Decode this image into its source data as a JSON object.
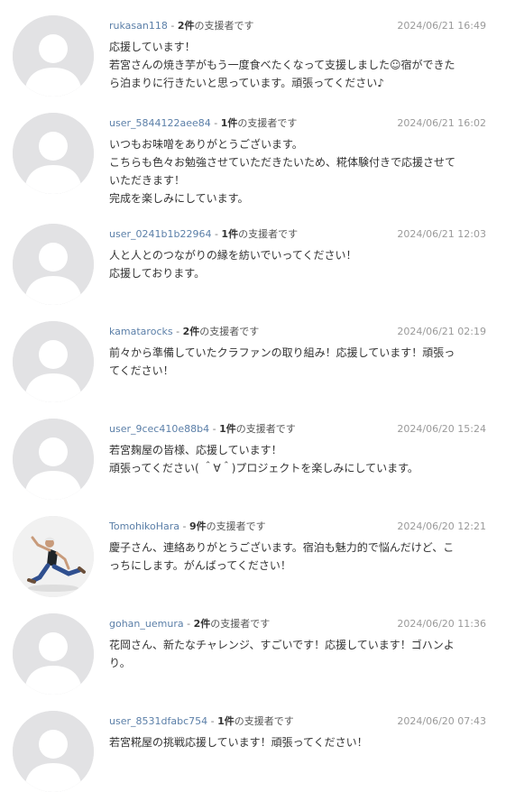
{
  "suffix": "の支援者です",
  "comments": [
    {
      "user": "rukasan118",
      "count": "2件",
      "date": "2024/06/21 16:49",
      "avatar": "default-avatar",
      "lines": [
        "応援しています！",
        "若宮さんの焼き芋がもう一度食べたくなって支援しました☺宿ができた",
        "ら泊まりに行きたいと思っています。頑張ってください♪"
      ]
    },
    {
      "user": "user_5844122aee84",
      "count": "1件",
      "date": "2024/06/21 16:02",
      "avatar": "default-avatar",
      "lines": [
        "いつもお味噌をありがとうございます。",
        "こちらも色々お勉強させていただきたいため、糀体験付きで応援させて",
        "いただきます！",
        "完成を楽しみにしています。"
      ]
    },
    {
      "user": "user_0241b1b22964",
      "count": "1件",
      "date": "2024/06/21 12:03",
      "avatar": "default-avatar",
      "lines": [
        "人と人とのつながりの縁を紡いでいってください！",
        "応援しております。"
      ]
    },
    {
      "user": "kamatarocks",
      "count": "2件",
      "date": "2024/06/21 02:19",
      "avatar": "default-avatar",
      "lines": [
        "前々から準備していたクラファンの取り組み！応援しています！頑張っ",
        "てください！"
      ]
    },
    {
      "user": "user_9cec410e88b4",
      "count": "1件",
      "date": "2024/06/20 15:24",
      "avatar": "default-avatar",
      "lines": [
        "若宮麹屋の皆様、応援しています！",
        "頑張ってください( ＾∀＾)プロジェクトを楽しみにしています。"
      ]
    },
    {
      "user": "TomohikoHara",
      "count": "9件",
      "date": "2024/06/20 12:21",
      "avatar": "jumping-person-photo",
      "lines": [
        "慶子さん、連絡ありがとうございます。宿泊も魅力的で悩んだけど、こ",
        "っちにします。がんばってください！"
      ]
    },
    {
      "user": "gohan_uemura",
      "count": "2件",
      "date": "2024/06/20 11:36",
      "avatar": "default-avatar",
      "lines": [
        "花岡さん、新たなチャレンジ、すごいです！応援しています！ゴハンよ",
        "り。"
      ]
    },
    {
      "user": "user_8531dfabc754",
      "count": "1件",
      "date": "2024/06/20 07:43",
      "avatar": "default-avatar",
      "lines": [
        "若宮糀屋の挑戦応援しています！頑張ってください！"
      ]
    }
  ]
}
